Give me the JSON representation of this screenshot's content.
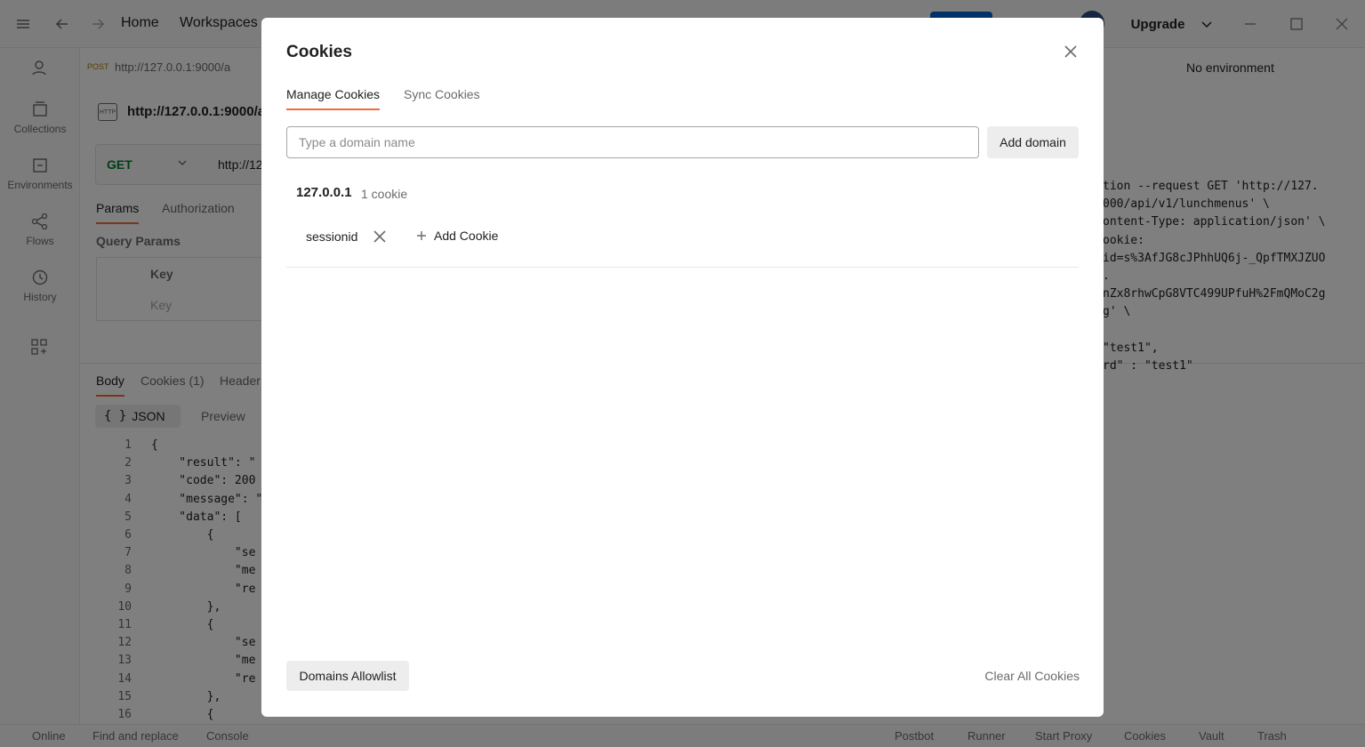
{
  "titlebar": {
    "home_label": "Home",
    "workspaces_label": "Workspaces",
    "upgrade_label": "Upgrade"
  },
  "sidebar": {
    "items": [
      {
        "label": "Collections",
        "icon": "collections-icon"
      },
      {
        "label": "Environments",
        "icon": "environments-icon"
      },
      {
        "label": "Flows",
        "icon": "flows-icon"
      },
      {
        "label": "History",
        "icon": "history-icon"
      }
    ]
  },
  "request": {
    "tab_method": "POST",
    "tab_url": "http://127.0.0.1:9000/a",
    "title": "http://127.0.0.1:9000/ap",
    "method": "GET",
    "url": "http://12",
    "http_badge": "HTTP",
    "subtabs": [
      "Params",
      "Authorization"
    ],
    "query_params_title": "Query Params",
    "key_header": "Key",
    "key_placeholder": "Key"
  },
  "response": {
    "tabs": [
      "Body",
      "Cookies (1)",
      "Header"
    ],
    "format": "JSON",
    "preview_label": "Preview",
    "lines": [
      {
        "n": "1",
        "t": "{"
      },
      {
        "n": "2",
        "t": "    \"result\": \""
      },
      {
        "n": "3",
        "t": "    \"code\": 200"
      },
      {
        "n": "4",
        "t": "    \"message\": \""
      },
      {
        "n": "5",
        "t": "    \"data\": ["
      },
      {
        "n": "6",
        "t": "        {"
      },
      {
        "n": "7",
        "t": "            \"se"
      },
      {
        "n": "8",
        "t": "            \"me"
      },
      {
        "n": "9",
        "t": "            \"re"
      },
      {
        "n": "10",
        "t": "        },"
      },
      {
        "n": "11",
        "t": "        {"
      },
      {
        "n": "12",
        "t": "            \"se"
      },
      {
        "n": "13",
        "t": "            \"me"
      },
      {
        "n": "14",
        "t": "            \"re"
      },
      {
        "n": "15",
        "t": "        },"
      },
      {
        "n": "16",
        "t": "        {"
      }
    ]
  },
  "right_panel": {
    "environment": "No environment",
    "code_lines": [
      "tion --request GET 'http://127.",
      "000/api/v1/lunchmenus' \\",
      "ontent-Type: application/json' \\",
      "ookie:",
      "id=s%3AfJG8cJPhhUQ6j-_QpfTMXJZUO",
      ".",
      "nZx8rhwCpG8VTC499UPfuH%2FmQMoC2g",
      "g' \\",
      "",
      "\"test1\",",
      "rd\" : \"test1\""
    ]
  },
  "statusbar": {
    "online": "Online",
    "find_replace": "Find and replace",
    "console": "Console",
    "postbot": "Postbot",
    "runner": "Runner",
    "start_proxy": "Start Proxy",
    "cookies": "Cookies",
    "vault": "Vault",
    "trash": "Trash"
  },
  "modal": {
    "title": "Cookies",
    "tabs": [
      "Manage Cookies",
      "Sync Cookies"
    ],
    "active_tab": "Manage Cookies",
    "domain_placeholder": "Type a domain name",
    "domain_value": "",
    "add_domain_label": "Add domain",
    "domains": [
      {
        "name": "127.0.0.1",
        "count_label": "1 cookie",
        "cookies": [
          {
            "name": "sessionid"
          }
        ]
      }
    ],
    "add_cookie_label": "Add Cookie",
    "allowlist_label": "Domains Allowlist",
    "clear_all_label": "Clear All Cookies"
  },
  "colors": {
    "accent": "#f26b3a",
    "get_method": "#007f31",
    "overlay": "rgba(0,0,0,0.5)"
  }
}
